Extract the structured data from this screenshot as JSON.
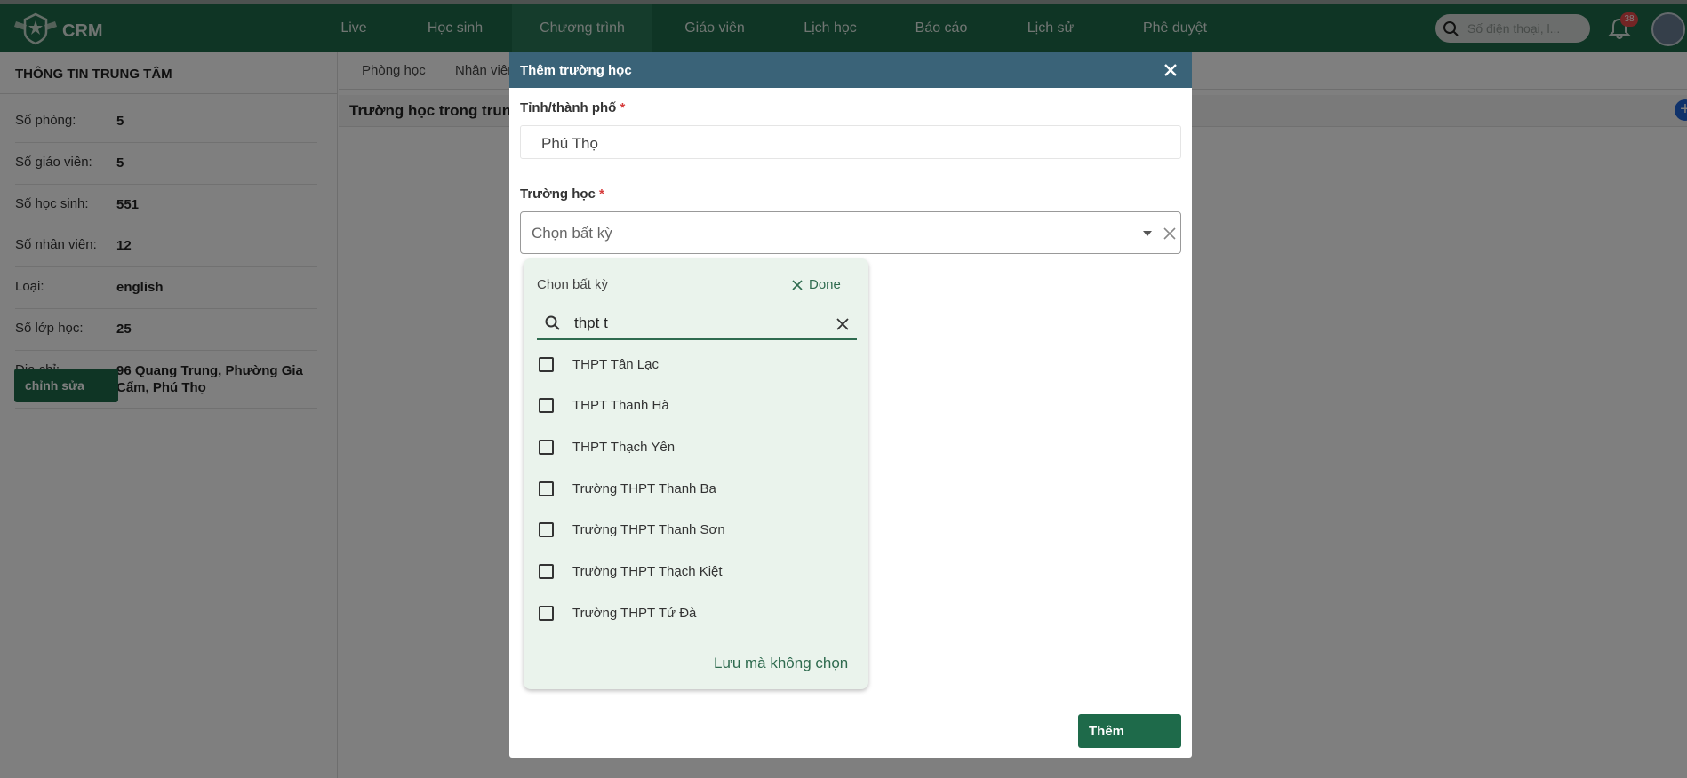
{
  "app": {
    "brand": "CRM"
  },
  "nav": {
    "items": [
      {
        "label": "Live"
      },
      {
        "label": "Học sinh"
      },
      {
        "label": "Chương trình"
      },
      {
        "label": "Giáo viên"
      },
      {
        "label": "Lịch học"
      },
      {
        "label": "Báo cáo"
      },
      {
        "label": "Lịch sử"
      },
      {
        "label": "Phê duyệt"
      }
    ],
    "active": "Chương trình",
    "search_placeholder": "Số điện thoại, l...",
    "notification_count": "38"
  },
  "left_panel": {
    "title": "THÔNG TIN TRUNG TÂM",
    "rows": [
      {
        "key": "Số phòng:",
        "value": "5"
      },
      {
        "key": "Số giáo viên:",
        "value": "5"
      },
      {
        "key": "Số học sinh:",
        "value": "551"
      },
      {
        "key": "Số nhân viên:",
        "value": "12"
      },
      {
        "key": "Loại:",
        "value": "english"
      },
      {
        "key": "Số lớp học:",
        "value": "25"
      },
      {
        "key": "Địa chỉ:",
        "value": "96 Quang Trung, Phường Gia Cẩm, Phú Thọ"
      }
    ],
    "edit_label": "chỉnh sửa"
  },
  "content": {
    "tabs": [
      {
        "label": "Phòng học"
      },
      {
        "label": "Nhân viên"
      }
    ],
    "section_title": "Trường học trong trung tâm"
  },
  "modal": {
    "title": "Thêm trường học",
    "province_label": "Tỉnh/thành phố",
    "required_mark": "*",
    "province_value": "Phú Thọ",
    "school_label": "Trường học",
    "school_placeholder": "Chọn bất kỳ",
    "dropdown": {
      "header": "Chọn bất kỳ",
      "done_label": "Done",
      "search_value": "thpt t",
      "options": [
        {
          "label": "THPT Tân Lạc",
          "checked": false
        },
        {
          "label": "THPT Thanh Hà",
          "checked": false
        },
        {
          "label": "THPT Thạch Yên",
          "checked": false
        },
        {
          "label": "Trường THPT Thanh Ba",
          "checked": false
        },
        {
          "label": "Trường THPT Thanh Sơn",
          "checked": false
        },
        {
          "label": "Trường THPT Thạch Kiệt",
          "checked": false
        },
        {
          "label": "Trường THPT Tứ Đà",
          "checked": false
        }
      ],
      "save_without_label": "Lưu mà không chọn"
    },
    "submit_label": "Thêm"
  },
  "colors": {
    "primary": "#1e6a4a",
    "modal_header": "#3a6378",
    "dropdown_bg": "#eaf3ec",
    "required": "#d63c3c"
  }
}
